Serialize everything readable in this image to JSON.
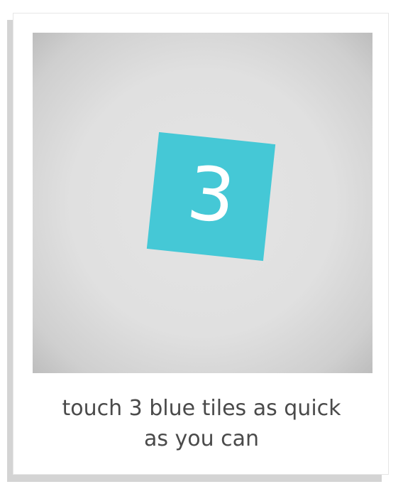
{
  "game": {
    "countdown_value": "3",
    "tile_color": "#45c8d6",
    "instruction_line1": "touch 3 blue tiles as quick",
    "instruction_line2": "as you can"
  }
}
